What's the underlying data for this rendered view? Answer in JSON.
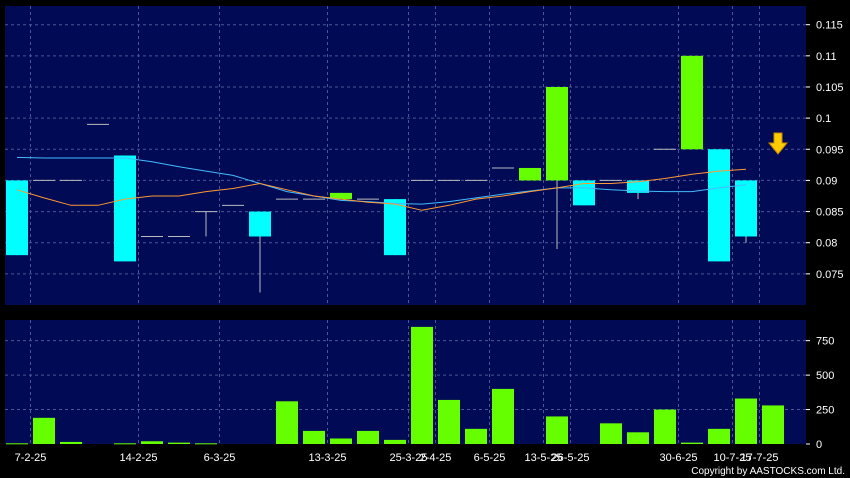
{
  "colors": {
    "background": "#000000",
    "panel": "#000a55",
    "grid": "#4c5595",
    "up": "#66ff00",
    "down": "#00ffff",
    "ma_short": "#ff9933",
    "ma_long": "#44bbff",
    "doji": "#bbbbbb",
    "arrow": "#ffcc00"
  },
  "copyright": "Copyright by AASTOCKS.com Ltd.",
  "chart_data": [
    {
      "type": "candlestick",
      "ylim": [
        0.07,
        0.118
      ],
      "y_ticks": [
        "0.075",
        "0.08",
        "0.085",
        "0.09",
        "0.095",
        "0.1",
        "0.105",
        "0.11",
        "0.115"
      ],
      "y_tick_values": [
        0.075,
        0.08,
        0.085,
        0.09,
        0.095,
        0.1,
        0.105,
        0.11,
        0.115
      ],
      "x_tick_labels": [
        "7-2-25",
        "14-2-25",
        "6-3-25",
        "13-3-25",
        "25-3-25",
        "2-4-25",
        "6-5-25",
        "13-5-25",
        "26-5-25",
        "30-6-25",
        "10-7-25",
        "17-7-25"
      ],
      "x_tick_index": [
        0,
        4,
        7,
        11,
        14,
        15,
        17,
        19,
        20,
        24,
        26,
        27
      ],
      "candles": [
        {
          "o": 0.09,
          "h": 0.09,
          "l": 0.078,
          "c": 0.078
        },
        {
          "o": 0.09,
          "h": 0.09,
          "l": 0.09,
          "c": 0.09
        },
        {
          "o": 0.09,
          "h": 0.09,
          "l": 0.09,
          "c": 0.09
        },
        {
          "o": 0.099,
          "h": 0.099,
          "l": 0.099,
          "c": 0.099
        },
        {
          "o": 0.094,
          "h": 0.094,
          "l": 0.077,
          "c": 0.077
        },
        {
          "o": 0.081,
          "h": 0.081,
          "l": 0.081,
          "c": 0.081
        },
        {
          "o": 0.081,
          "h": 0.081,
          "l": 0.081,
          "c": 0.081
        },
        {
          "o": 0.085,
          "h": 0.085,
          "l": 0.081,
          "c": 0.085
        },
        {
          "o": 0.086,
          "h": 0.086,
          "l": 0.086,
          "c": 0.086
        },
        {
          "o": 0.085,
          "h": 0.085,
          "l": 0.072,
          "c": 0.081
        },
        {
          "o": 0.087,
          "h": 0.087,
          "l": 0.087,
          "c": 0.087
        },
        {
          "o": 0.087,
          "h": 0.087,
          "l": 0.087,
          "c": 0.087
        },
        {
          "o": 0.087,
          "h": 0.088,
          "l": 0.087,
          "c": 0.088
        },
        {
          "o": 0.087,
          "h": 0.087,
          "l": 0.087,
          "c": 0.087
        },
        {
          "o": 0.087,
          "h": 0.087,
          "l": 0.078,
          "c": 0.078
        },
        {
          "o": 0.09,
          "h": 0.09,
          "l": 0.09,
          "c": 0.09
        },
        {
          "o": 0.09,
          "h": 0.09,
          "l": 0.09,
          "c": 0.09
        },
        {
          "o": 0.09,
          "h": 0.09,
          "l": 0.09,
          "c": 0.09
        },
        {
          "o": 0.092,
          "h": 0.092,
          "l": 0.092,
          "c": 0.092
        },
        {
          "o": 0.09,
          "h": 0.092,
          "l": 0.09,
          "c": 0.092
        },
        {
          "o": 0.09,
          "h": 0.105,
          "l": 0.079,
          "c": 0.105
        },
        {
          "o": 0.09,
          "h": 0.09,
          "l": 0.086,
          "c": 0.086
        },
        {
          "o": 0.09,
          "h": 0.09,
          "l": 0.09,
          "c": 0.09
        },
        {
          "o": 0.09,
          "h": 0.09,
          "l": 0.087,
          "c": 0.088
        },
        {
          "o": 0.095,
          "h": 0.095,
          "l": 0.095,
          "c": 0.095
        },
        {
          "o": 0.095,
          "h": 0.11,
          "l": 0.095,
          "c": 0.11
        },
        {
          "o": 0.095,
          "h": 0.095,
          "l": 0.077,
          "c": 0.077
        },
        {
          "o": 0.09,
          "h": 0.09,
          "l": 0.08,
          "c": 0.081
        }
      ],
      "ma_short": [
        0.0885,
        0.0872,
        0.086,
        0.086,
        0.087,
        0.0875,
        0.0875,
        0.0882,
        0.0887,
        0.0895,
        0.0885,
        0.0875,
        0.087,
        0.0865,
        0.0862,
        0.0852,
        0.086,
        0.087,
        0.0875,
        0.0882,
        0.0888,
        0.0895,
        0.0895,
        0.0898,
        0.0903,
        0.091,
        0.0915,
        0.0918
      ],
      "ma_long": [
        0.0937,
        0.0936,
        0.0936,
        0.0936,
        0.0936,
        0.093,
        0.0922,
        0.0915,
        0.0908,
        0.0895,
        0.0882,
        0.0875,
        0.0868,
        0.0866,
        0.0863,
        0.0862,
        0.0866,
        0.0872,
        0.0878,
        0.0883,
        0.0888,
        0.0888,
        0.0885,
        0.0883,
        0.0882,
        0.0882,
        0.0888,
        0.0893
      ]
    },
    {
      "type": "bar",
      "ylim": [
        0,
        900
      ],
      "y_ticks": [
        "0",
        "250",
        "500",
        "750"
      ],
      "y_tick_values": [
        0,
        250,
        500,
        750
      ],
      "volumes": [
        5,
        190,
        15,
        0,
        5,
        20,
        10,
        5,
        0,
        0,
        310,
        95,
        40,
        95,
        30,
        850,
        320,
        110,
        400,
        0,
        200,
        0,
        150,
        85,
        250,
        10,
        110,
        330,
        280
      ]
    }
  ]
}
